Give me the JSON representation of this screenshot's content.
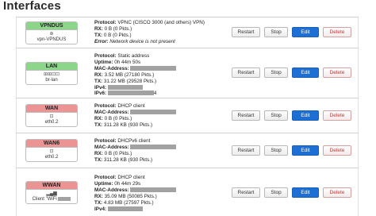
{
  "page": {
    "title": "Interfaces"
  },
  "buttons": {
    "restart": "Restart",
    "stop": "Stop",
    "edit": "Edit",
    "delete": "Delete"
  },
  "colors": {
    "edit_button": "#1e6fd3",
    "badge_green": "#8cd68a",
    "badge_red": "#ec9494",
    "redaction": "#a2a2a2"
  },
  "interfaces": [
    {
      "name": "VPNDUS",
      "header_color": "green",
      "icon": "vpn-globe-icon",
      "device": "vpn-VPNDUS",
      "lines": {
        "protocol_label": "Protocol:",
        "protocol": "VPNC (CISCO 3000 (and others) VPN)",
        "rx_label": "RX:",
        "rx": "0 B (0 Pkts.)",
        "tx_label": "TX:",
        "tx": "0 B (0 Pkts.)",
        "error_label": "Error:",
        "error": "Network device is not present"
      }
    },
    {
      "name": "LAN",
      "header_color": "green",
      "icon": "bridge-ports-icon",
      "device": "br-lan",
      "lines": {
        "protocol_label": "Protocol:",
        "protocol": "Static address",
        "uptime_label": "Uptime:",
        "uptime": "0h 44m 50s",
        "mac_label": "MAC-Address:",
        "rx_label": "RX:",
        "rx": "3.52 MB (27180 Pkts.)",
        "tx_label": "TX:",
        "tx": "31.22 MB (29528 Pkts.)",
        "ipv4_label": "IPv4:",
        "ipv6_label": "IPv6:",
        "ipv6_suffix": "4"
      }
    },
    {
      "name": "WAN",
      "header_color": "red",
      "icon": "ethernet-port-icon",
      "device": "eth0.2",
      "lines": {
        "protocol_label": "Protocol:",
        "protocol": "DHCP client",
        "mac_label": "MAC-Address:",
        "rx_label": "RX:",
        "rx": "0 B (0 Pkts.)",
        "tx_label": "TX:",
        "tx": "311.28 KB (930 Pkts.)"
      }
    },
    {
      "name": "WAN6",
      "header_color": "red",
      "icon": "ethernet-port-icon",
      "device": "eth0.2",
      "lines": {
        "protocol_label": "Protocol:",
        "protocol": "DHCPv6 client",
        "mac_label": "MAC-Address:",
        "rx_label": "RX:",
        "rx": "0 B (0 Pkts.)",
        "tx_label": "TX:",
        "tx": "311.28 KB (930 Pkts.)"
      }
    },
    {
      "name": "WWAN",
      "header_color": "red",
      "icon": "wifi-signal-icon",
      "device": "Client \"WiFi",
      "lines": {
        "protocol_label": "Protocol:",
        "protocol": "DHCP client",
        "uptime_label": "Uptime:",
        "uptime": "0h 44m 29s",
        "mac_label": "MAC-Address:",
        "rx_label": "RX:",
        "rx": "35.09 MB (50085 Pkts.)",
        "tx_label": "TX:",
        "tx": "4.83 MB (27597 Pkts.)",
        "ipv4_label": "IPv4:"
      }
    }
  ]
}
